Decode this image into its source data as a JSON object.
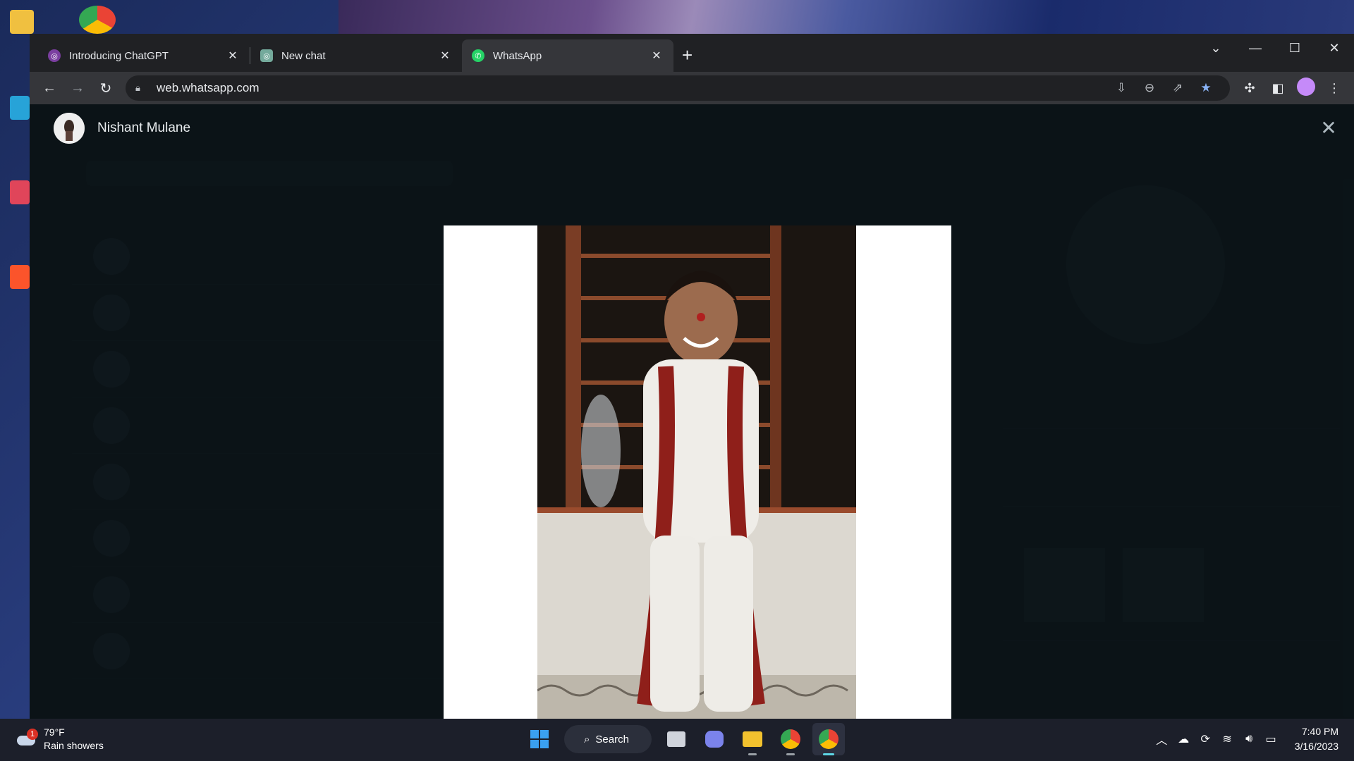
{
  "browser": {
    "tabs": [
      {
        "title": "Introducing ChatGPT",
        "favicon": "chatgpt-icon",
        "active": false
      },
      {
        "title": "New chat",
        "favicon": "chatgpt-icon",
        "active": false
      },
      {
        "title": "WhatsApp",
        "favicon": "whatsapp-icon",
        "active": true
      }
    ],
    "url": "web.whatsapp.com"
  },
  "viewer": {
    "contact_name": "Nishant Mulane"
  },
  "taskbar": {
    "weather": {
      "temp": "79°F",
      "condition": "Rain showers",
      "badge": "1"
    },
    "search_label": "Search",
    "time": "7:40 PM",
    "date": "3/16/2023"
  },
  "colors": {
    "whatsapp_green": "#25d366",
    "viewer_bg": "#0b1418",
    "chrome_dark": "#202124"
  }
}
